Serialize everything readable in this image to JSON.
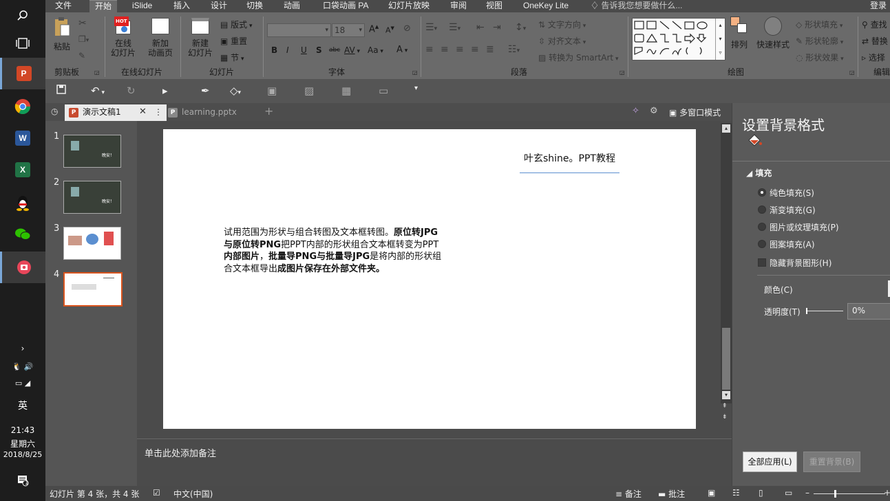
{
  "taskbar": {
    "apps": [
      "search-icon",
      "task-view-icon",
      "powerpoint-icon",
      "chrome-icon",
      "word-icon",
      "excel-icon",
      "qq-icon",
      "wechat-icon",
      "screenrec-icon"
    ],
    "ppt_letter": "P",
    "word_letter": "W",
    "excel_letter": "X",
    "ime": "英",
    "time": "21:43",
    "weekday": "星期六",
    "date": "2018/8/25",
    "notify_badge": "1"
  },
  "ribbon_tabs": [
    "文件",
    "开始",
    "iSlide",
    "插入",
    "设计",
    "切换",
    "动画",
    "口袋动画 PA",
    "幻灯片放映",
    "审阅",
    "视图",
    "OneKey Lite"
  ],
  "active_tab": "开始",
  "tell_me": "告诉我您想要做什么...",
  "login": "登录",
  "ribbon": {
    "clipboard": {
      "paste": "粘贴",
      "label": "剪贴板"
    },
    "online": {
      "online_slide": "在线\n幻灯片",
      "new_anim": "新加\n动画页",
      "label": "在线幻灯片",
      "hot": "HOT"
    },
    "slides": {
      "new_slide": "新建\n幻灯片",
      "layout": "版式",
      "reset": "重置",
      "section": "节",
      "label": "幻灯片"
    },
    "font": {
      "font_size": "18",
      "label": "字体",
      "bold": "B",
      "italic": "I",
      "underline": "U",
      "shadow": "S",
      "strike": "abc",
      "spacing": "AV",
      "case": "Aa",
      "color": "A",
      "grow": "A",
      "shrink": "A"
    },
    "paragraph": {
      "text_dir": "文字方向",
      "align_text": "对齐文本",
      "smartart": "转换为 SmartArt",
      "label": "段落"
    },
    "drawing": {
      "arrange": "排列",
      "quick_styles": "快速样式",
      "fill": "形状填充",
      "outline": "形状轮廓",
      "effects": "形状效果",
      "label": "绘图"
    },
    "editing": {
      "find": "查找",
      "replace": "替换",
      "select": "选择",
      "label": "编辑"
    }
  },
  "doc_tabs": [
    {
      "name": "演示文稿1",
      "active": true
    },
    {
      "name": "learning.pptx",
      "active": false
    }
  ],
  "multi_window": "多窗口模式",
  "thumbnails": [
    "1",
    "2",
    "3",
    "4"
  ],
  "thumb_caption": "晚安！",
  "selected_slide": 4,
  "slide": {
    "title": "叶玄shine。PPT教程",
    "body": [
      {
        "t": "试用范围为形状与组合转图及文本框转图。",
        "b": false
      },
      {
        "t": "原位转JPG与原位转PNG",
        "b": true
      },
      {
        "t": "把PPT内部的形状组合文本框转变为PPT",
        "b": false
      },
      {
        "t": "内部图片",
        "b": true
      },
      {
        "t": "，",
        "b": false
      },
      {
        "t": "批量导PNG与批量导JPG",
        "b": true
      },
      {
        "t": "是将内部的形状组合文本框导出",
        "b": false
      },
      {
        "t": "成图片保存在外部文件夹",
        "b": true
      },
      {
        "t": "。",
        "b": true
      }
    ]
  },
  "notes_placeholder": "单击此处添加备注",
  "pane": {
    "title": "设置背景格式",
    "section": "填充",
    "options": [
      "纯色填充(S)",
      "渐变填充(G)",
      "图片或纹理填充(P)",
      "图案填充(A)"
    ],
    "selected_option": 0,
    "hide_bg": "隐藏背景图形(H)",
    "color": "颜色(C)",
    "transparency": "透明度(T)",
    "transparency_value": "0%",
    "apply_all": "全部应用(L)",
    "reset_bg": "重置背景(B)"
  },
  "status": {
    "slide_info": "幻灯片 第 4 张，共 4 张",
    "language": "中文(中国)",
    "notes": "备注",
    "comments": "批注"
  }
}
